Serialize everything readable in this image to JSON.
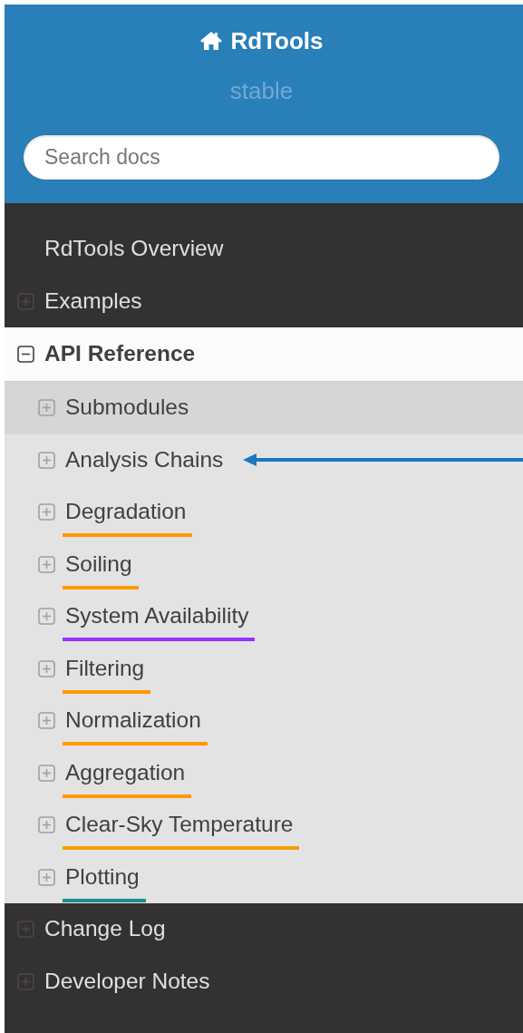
{
  "header": {
    "title": "RdTools",
    "version": "stable",
    "search": {
      "placeholder": "Search docs"
    }
  },
  "nav": [
    {
      "label": "RdTools Overview",
      "current": false
    },
    {
      "label": "Examples",
      "expanded": false,
      "current": false
    },
    {
      "label": "API Reference",
      "expanded": true,
      "current": true,
      "children": [
        {
          "label": "Submodules",
          "expanded": false,
          "current": true,
          "arrow": false
        },
        {
          "label": "Analysis Chains",
          "expanded": false,
          "current": false,
          "arrow": true
        },
        {
          "label": "Degradation",
          "expanded": false,
          "current": false,
          "arrow": false,
          "color": "#ff9900"
        },
        {
          "label": "Soiling",
          "expanded": false,
          "current": false,
          "arrow": false,
          "color": "#ff9900"
        },
        {
          "label": "System Availability",
          "expanded": false,
          "current": false,
          "arrow": false,
          "color": "#9933ff"
        },
        {
          "label": "Filtering",
          "expanded": false,
          "current": false,
          "arrow": false,
          "color": "#ff9900"
        },
        {
          "label": "Normalization",
          "expanded": false,
          "current": false,
          "arrow": false,
          "color": "#ff9900"
        },
        {
          "label": "Aggregation",
          "expanded": false,
          "current": false,
          "arrow": false,
          "color": "#ff9900"
        },
        {
          "label": "Clear-Sky Temperature",
          "expanded": false,
          "current": false,
          "arrow": false,
          "color": "#ff9900"
        },
        {
          "label": "Plotting",
          "expanded": false,
          "current": false,
          "arrow": false,
          "color": "#1a9090"
        }
      ]
    },
    {
      "label": "Change Log",
      "expanded": false,
      "current": false
    },
    {
      "label": "Developer Notes",
      "expanded": false,
      "current": false
    }
  ]
}
